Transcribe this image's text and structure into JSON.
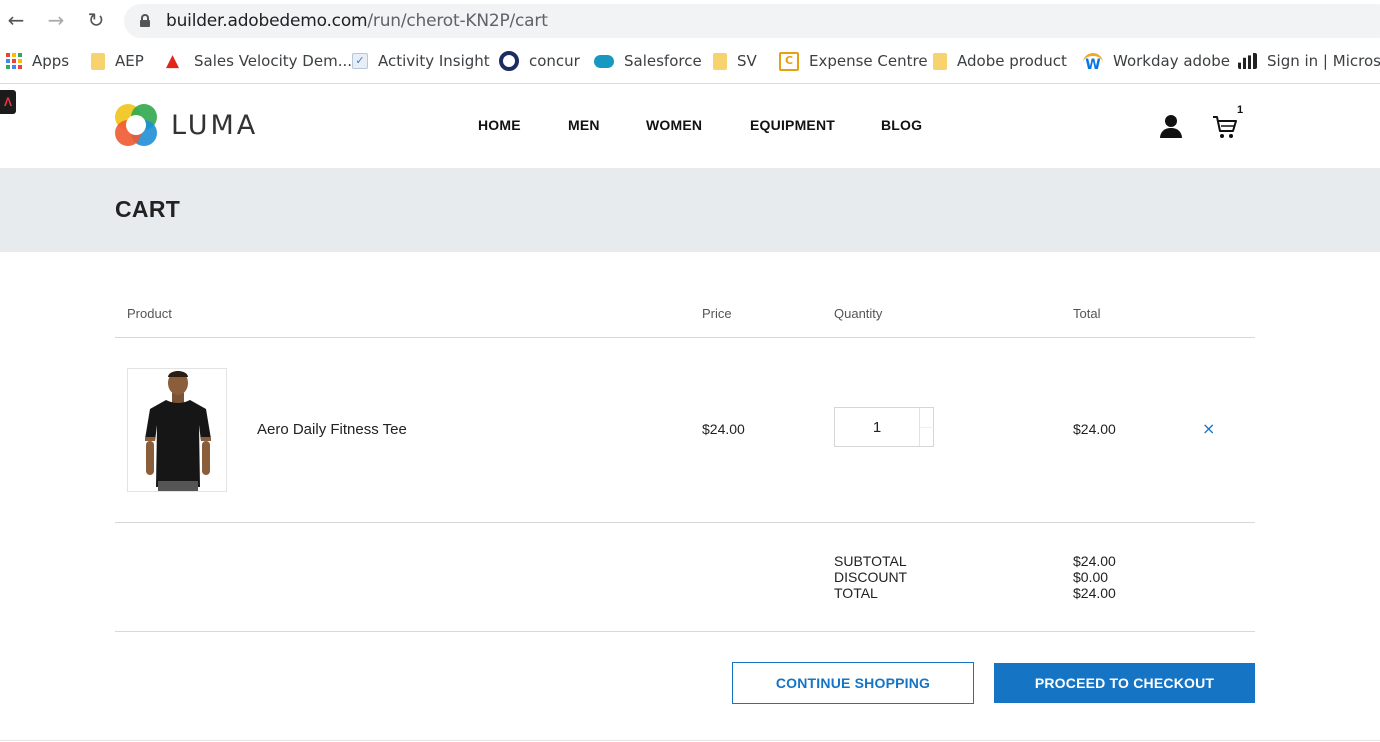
{
  "browser": {
    "url_host": "builder.adobedemo.com",
    "url_path": "/run/cherot-KN2P/cart",
    "bookmarks": [
      {
        "label": "Apps",
        "icon": "apps-grid-icon"
      },
      {
        "label": "AEP",
        "icon": "folder-icon"
      },
      {
        "label": "Sales Velocity Dem...",
        "icon": "adobe-icon"
      },
      {
        "label": "Activity Insight",
        "icon": "checkbox-icon"
      },
      {
        "label": "concur",
        "icon": "concur-icon"
      },
      {
        "label": "Salesforce",
        "icon": "salesforce-cloud-icon"
      },
      {
        "label": "SV",
        "icon": "folder-icon"
      },
      {
        "label": "Expense Centre",
        "icon": "expense-icon"
      },
      {
        "label": "Adobe product",
        "icon": "folder-icon"
      },
      {
        "label": "Workday adobe",
        "icon": "workday-icon"
      },
      {
        "label": "Sign in | Microsof",
        "icon": "bars-icon"
      }
    ]
  },
  "header": {
    "brand": "LUMA",
    "nav": [
      "HOME",
      "MEN",
      "WOMEN",
      "EQUIPMENT",
      "BLOG"
    ],
    "cart_count": "1"
  },
  "page": {
    "title": "CART"
  },
  "cart": {
    "columns": [
      "Product",
      "Price",
      "Quantity",
      "Total"
    ],
    "items": [
      {
        "name": "Aero Daily Fitness Tee",
        "price": "$24.00",
        "quantity": "1",
        "total": "$24.00",
        "remove": "×"
      }
    ],
    "summary": {
      "subtotal_label": "SUBTOTAL",
      "discount_label": "DISCOUNT",
      "total_label": "TOTAL",
      "subtotal": "$24.00",
      "discount": "$0.00",
      "total": "$24.00"
    }
  },
  "actions": {
    "continue": "CONTINUE SHOPPING",
    "checkout": "PROCEED TO CHECKOUT"
  },
  "colors": {
    "accent": "#1674c4",
    "band": "#e8ebee"
  }
}
